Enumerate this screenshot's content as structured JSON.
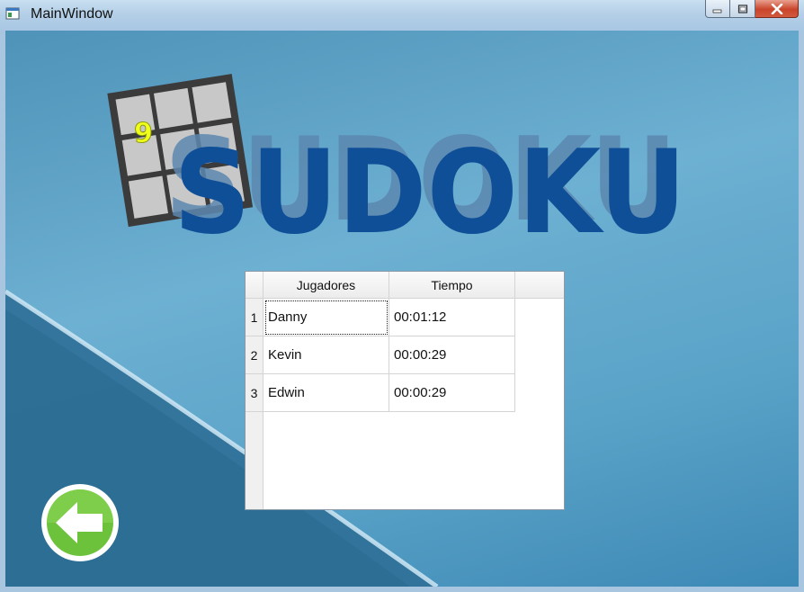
{
  "window": {
    "title": "MainWindow",
    "controls": {
      "minimize": "minimize-icon",
      "maximize": "maximize-icon",
      "close": "close-icon"
    }
  },
  "logo": {
    "text": "SUDOKU",
    "grid_digit": "9",
    "colors": {
      "text": "#0f4f98",
      "shadow": "#5c88b0",
      "grid": "#3b3b3b",
      "cell": "#c8c8c8",
      "digit": "#f2ff1a"
    }
  },
  "table": {
    "headers": [
      "Jugadores",
      "Tiempo"
    ],
    "rows": [
      {
        "index": "1",
        "player": "Danny",
        "time": "00:01:12"
      },
      {
        "index": "2",
        "player": "Kevin",
        "time": "00:00:29"
      },
      {
        "index": "3",
        "player": "Edwin",
        "time": "00:00:29"
      }
    ]
  },
  "back_button": {
    "icon": "arrow-left-icon",
    "colors": {
      "fill": "#6cc23a",
      "ring": "#ffffff"
    }
  }
}
